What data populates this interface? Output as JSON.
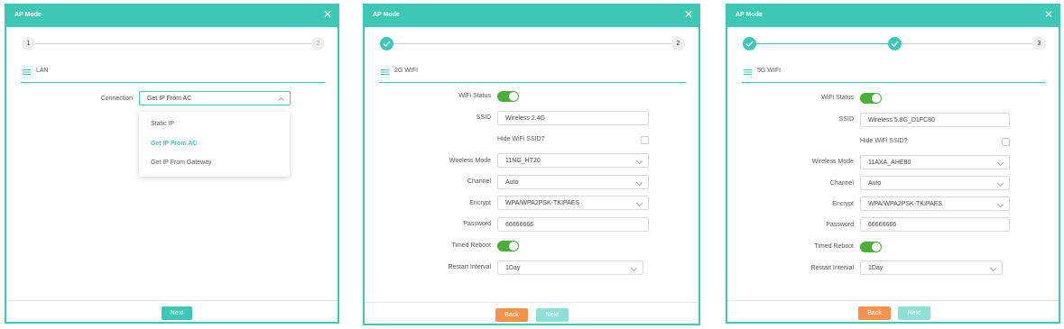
{
  "colors": {
    "accent": "#3cc8b4",
    "toggle_on": "#4caf3a",
    "back_button": "#f5924c"
  },
  "panels": [
    {
      "title": "AP Mode",
      "close_icon": "close-icon",
      "steps": [
        "1",
        "2"
      ],
      "section": "LAN",
      "connection": {
        "label": "Connection",
        "value": "Get IP From AC",
        "options": [
          "Static IP",
          "Get IP From AC",
          "Get IP From Gateway"
        ]
      },
      "next": "Next"
    },
    {
      "title": "AP Mode",
      "close_icon": "close-icon",
      "steps": [
        "2"
      ],
      "section": "2G WIFI",
      "fields": {
        "wifi_status": "WiFi Status",
        "ssid_label": "SSID",
        "ssid_value": "Wireless 2.4G",
        "hide_ssid": "Hide WiFi SSID?",
        "mode_label": "Wireless Mode",
        "mode_value": "11NG_HT20",
        "channel_label": "Channel",
        "channel_value": "Auto",
        "encrypt_label": "Encrypt",
        "encrypt_value": "WPA/WPA2PSK-TKIPAES",
        "password_label": "Password",
        "password_value": "66666666",
        "reboot_label": "Timed Reboot",
        "interval_label": "Restart Interval",
        "interval_value": "1Day"
      },
      "back": "Back",
      "next": "Next"
    },
    {
      "title": "AP Mode",
      "close_icon": "close-icon",
      "steps": [
        "3"
      ],
      "section": "5G WIFI",
      "fields": {
        "wifi_status": "WiFi Status",
        "ssid_label": "SSID",
        "ssid_value": "Wireless 5.8G_D1FC80",
        "hide_ssid": "Hide WiFi SSID?",
        "mode_label": "Wireless Mode",
        "mode_value": "11AXA_AHE80",
        "channel_label": "Channel",
        "channel_value": "Auto",
        "encrypt_label": "Encrypt",
        "encrypt_value": "WPA/WPA2PSK-TKIPAES",
        "password_label": "Password",
        "password_value": "66666666",
        "reboot_label": "Timed Reboot",
        "interval_label": "Restart Interval",
        "interval_value": "1Day"
      },
      "back": "Back",
      "next": "Next"
    }
  ]
}
